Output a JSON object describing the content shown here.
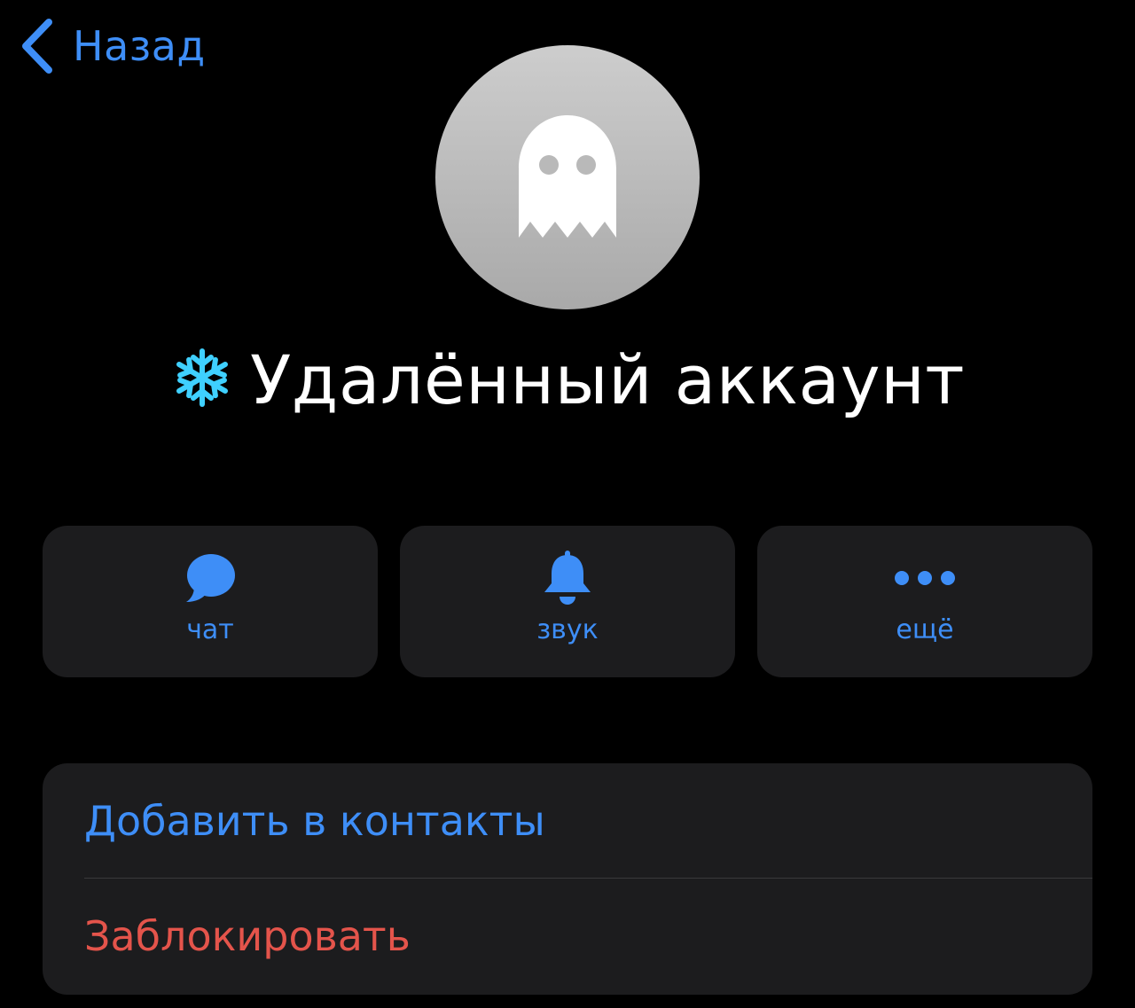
{
  "nav": {
    "back_label": "Назад",
    "back_icon": "chevron-left-icon"
  },
  "profile": {
    "avatar_icon": "ghost-icon",
    "name_emoji_icon": "snowflake-icon",
    "name": "Удалённый аккаунт"
  },
  "actions": [
    {
      "icon": "chat-bubble-icon",
      "label": "чат"
    },
    {
      "icon": "bell-icon",
      "label": "звук"
    },
    {
      "icon": "ellipsis-icon",
      "label": "ещё"
    }
  ],
  "options": {
    "add_contact_label": "Добавить в контакты",
    "block_label": "Заблокировать"
  },
  "colors": {
    "background": "#000000",
    "accent_blue": "#3e8ef7",
    "destructive_red": "#e4544b",
    "card_background": "#1c1c1e",
    "text_primary": "#ffffff",
    "snowflake_cyan": "#3fd0ff"
  }
}
